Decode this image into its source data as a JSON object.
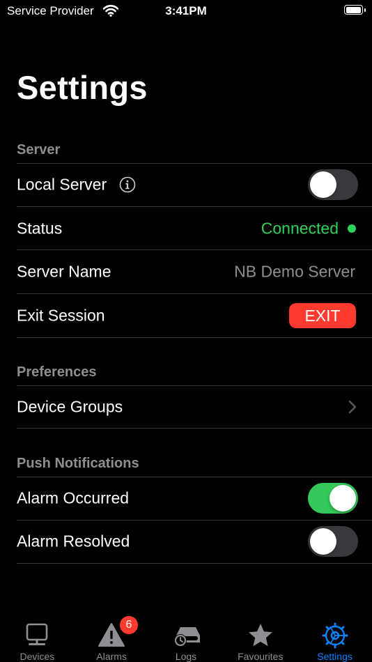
{
  "status_bar": {
    "carrier": "Service Provider",
    "time": "3:41PM"
  },
  "page": {
    "title": "Settings"
  },
  "sections": {
    "server": {
      "header": "Server",
      "local_server_label": "Local Server",
      "local_server_on": false,
      "status_label": "Status",
      "status_value": "Connected",
      "status_color": "#30d158",
      "server_name_label": "Server Name",
      "server_name_value": "NB Demo Server",
      "exit_session_label": "Exit Session",
      "exit_button_label": "EXIT"
    },
    "preferences": {
      "header": "Preferences",
      "device_groups_label": "Device Groups"
    },
    "push": {
      "header": "Push Notifications",
      "alarm_occurred_label": "Alarm Occurred",
      "alarm_occurred_on": true,
      "alarm_resolved_label": "Alarm Resolved",
      "alarm_resolved_on": false
    }
  },
  "tabs": [
    {
      "label": "Devices",
      "icon": "monitor-icon",
      "active": false
    },
    {
      "label": "Alarms",
      "icon": "warning-icon",
      "active": false,
      "badge": "6"
    },
    {
      "label": "Logs",
      "icon": "logs-icon",
      "active": false
    },
    {
      "label": "Favourites",
      "icon": "star-icon",
      "active": false
    },
    {
      "label": "Settings",
      "icon": "settings-gear-icon",
      "active": true
    }
  ],
  "colors": {
    "accent": "#0a84ff",
    "toggle_on": "#34c759",
    "danger": "#ff3b30",
    "secondary_text": "#8e8e93"
  }
}
